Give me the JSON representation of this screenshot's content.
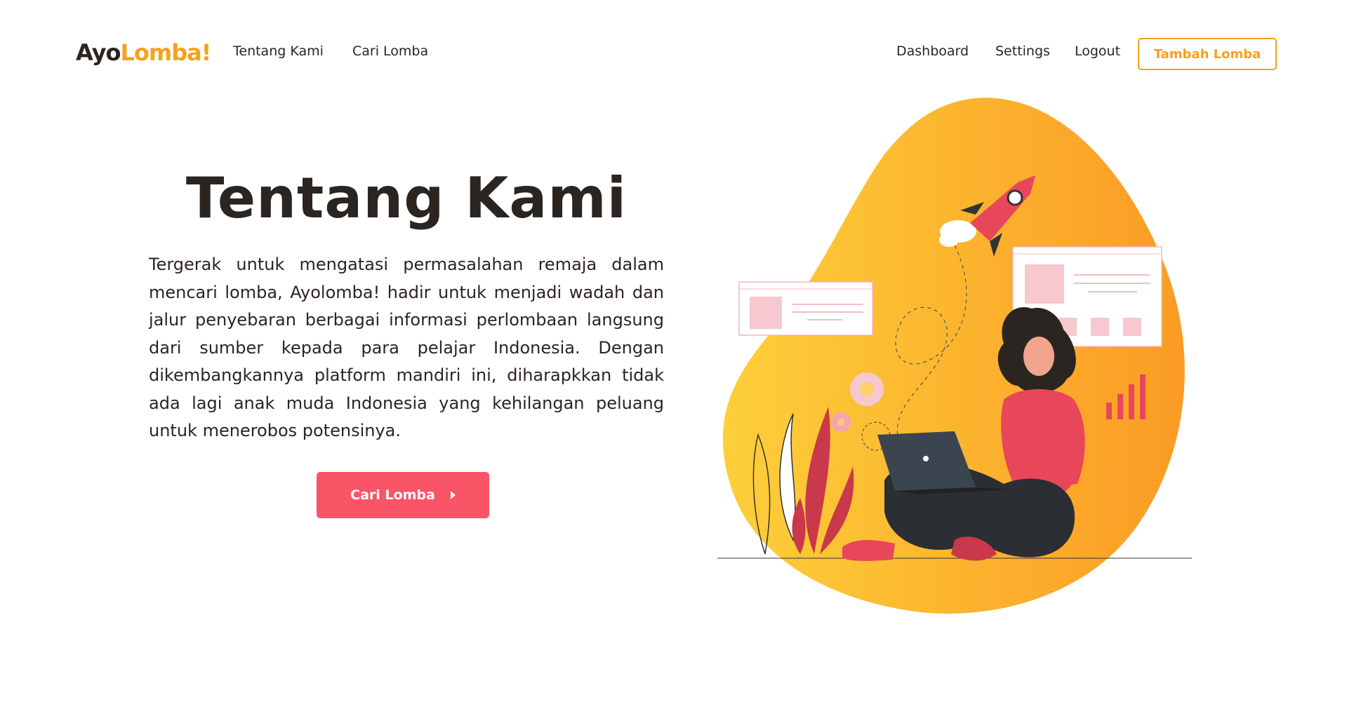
{
  "nav": {
    "logo_part1": "Ayo",
    "logo_part2": "Lomba!",
    "links_left": [
      "Tentang Kami",
      "Cari Lomba"
    ],
    "links_right": [
      "Dashboard",
      "Settings",
      "Logout"
    ],
    "cta_label": "Tambah Lomba"
  },
  "hero": {
    "title": "Tentang Kami",
    "description": "Tergerak untuk mengatasi permasalahan remaja dalam mencari lomba, Ayolomba! hadir untuk menjadi wadah dan jalur penyebaran berbagai informasi perlombaan langsung dari sumber kepada para pelajar Indonesia. Dengan dikembangkannya platform mandiri ini, diharapkkan tidak ada lagi anak muda Indonesia yang kehilangan peluang untuk menerobos potensinya.",
    "button_label": "Cari Lomba",
    "button_icon": "chevron-right-icon"
  },
  "colors": {
    "accent_orange": "#f6a11e",
    "primary_pink": "#fa5467",
    "text_dark": "#2b2521"
  }
}
